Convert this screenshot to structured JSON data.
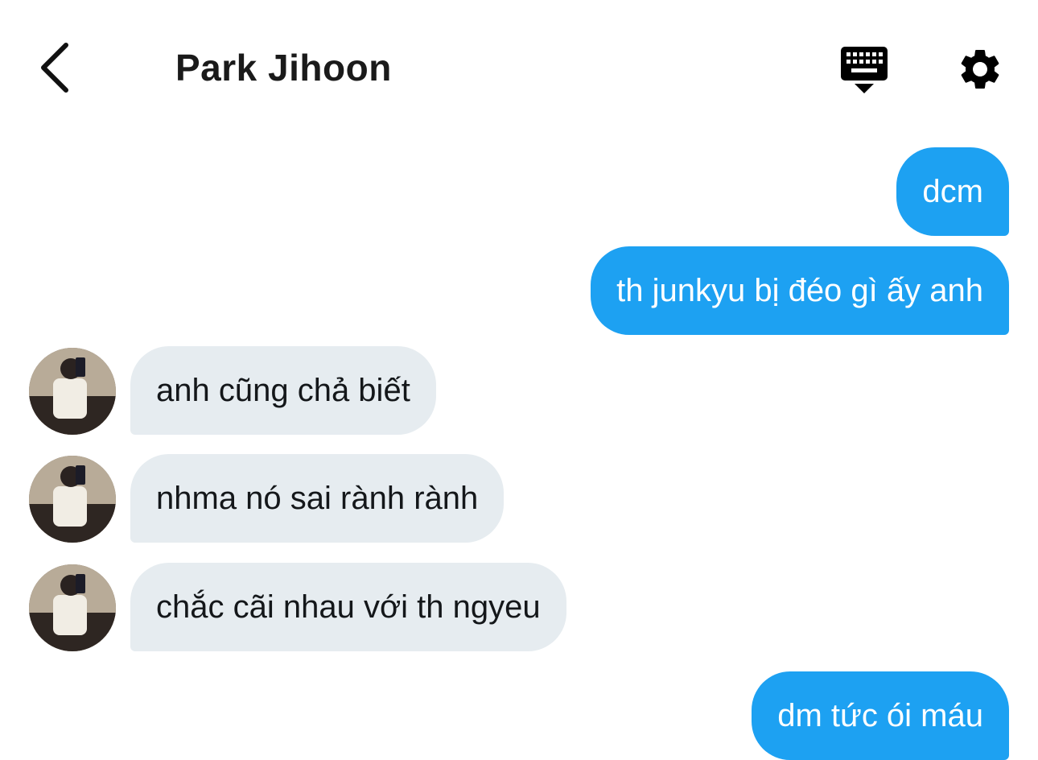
{
  "header": {
    "title": "Park Jihoon",
    "back_icon": "chevron-left-icon",
    "keyboard_icon": "keyboard-icon",
    "settings_icon": "gear-icon"
  },
  "messages": [
    {
      "side": "sent",
      "text": "dcm"
    },
    {
      "side": "sent",
      "text": "th junkyu bị đéo gì ấy anh"
    },
    {
      "side": "received",
      "text": "anh cũng chả biết"
    },
    {
      "side": "received",
      "text": "nhma nó sai rành rành"
    },
    {
      "side": "received",
      "text": "chắc cãi nhau với th ngyeu"
    },
    {
      "side": "sent",
      "text": "dm tức ói máu"
    }
  ],
  "colors": {
    "sent_bubble": "#1da1f2",
    "received_bubble": "#e6ecf0",
    "text_dark": "#14171a"
  }
}
